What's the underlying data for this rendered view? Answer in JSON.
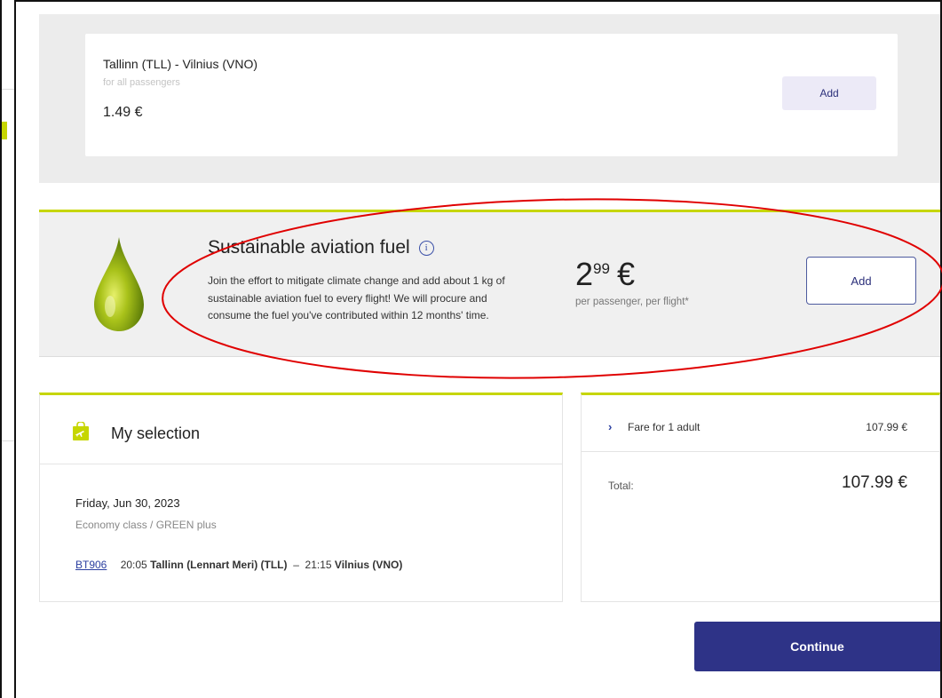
{
  "route_offer": {
    "title": "Tallinn (TLL) - Vilnius (VNO)",
    "subtitle": "for all passengers",
    "price": "1.49 €",
    "add_label": "Add"
  },
  "saf": {
    "title": "Sustainable aviation fuel",
    "info_icon": "info-icon",
    "description": "Join the effort to mitigate climate change and add about 1 kg of sustainable aviation fuel to every flight! We will procure and consume the fuel you've contributed within 12 months' time.",
    "price_int": "2",
    "price_dec": "99",
    "currency": "€",
    "price_note": "per passenger, per flight*",
    "add_label": "Add",
    "icon": "fuel-drop-icon"
  },
  "selection": {
    "title": "My selection",
    "icon": "shopping-bag-icon",
    "date": "Friday, Jun 30, 2023",
    "fare_class": "Economy class / GREEN plus",
    "flight_number": "BT906",
    "dep_time": "20:05",
    "dep_airport": "Tallinn (Lennart Meri) (TLL)",
    "separator": "–",
    "arr_time": "21:15",
    "arr_airport": "Vilnius (VNO)"
  },
  "fare": {
    "row_label": "Fare for 1 adult",
    "row_value": "107.99 €",
    "total_label": "Total:",
    "total_value": "107.99 €"
  },
  "continue_label": "Continue",
  "colors": {
    "accent_lime": "#c6d600",
    "brand_navy": "#2e3387",
    "annotation_red": "#e00000"
  }
}
